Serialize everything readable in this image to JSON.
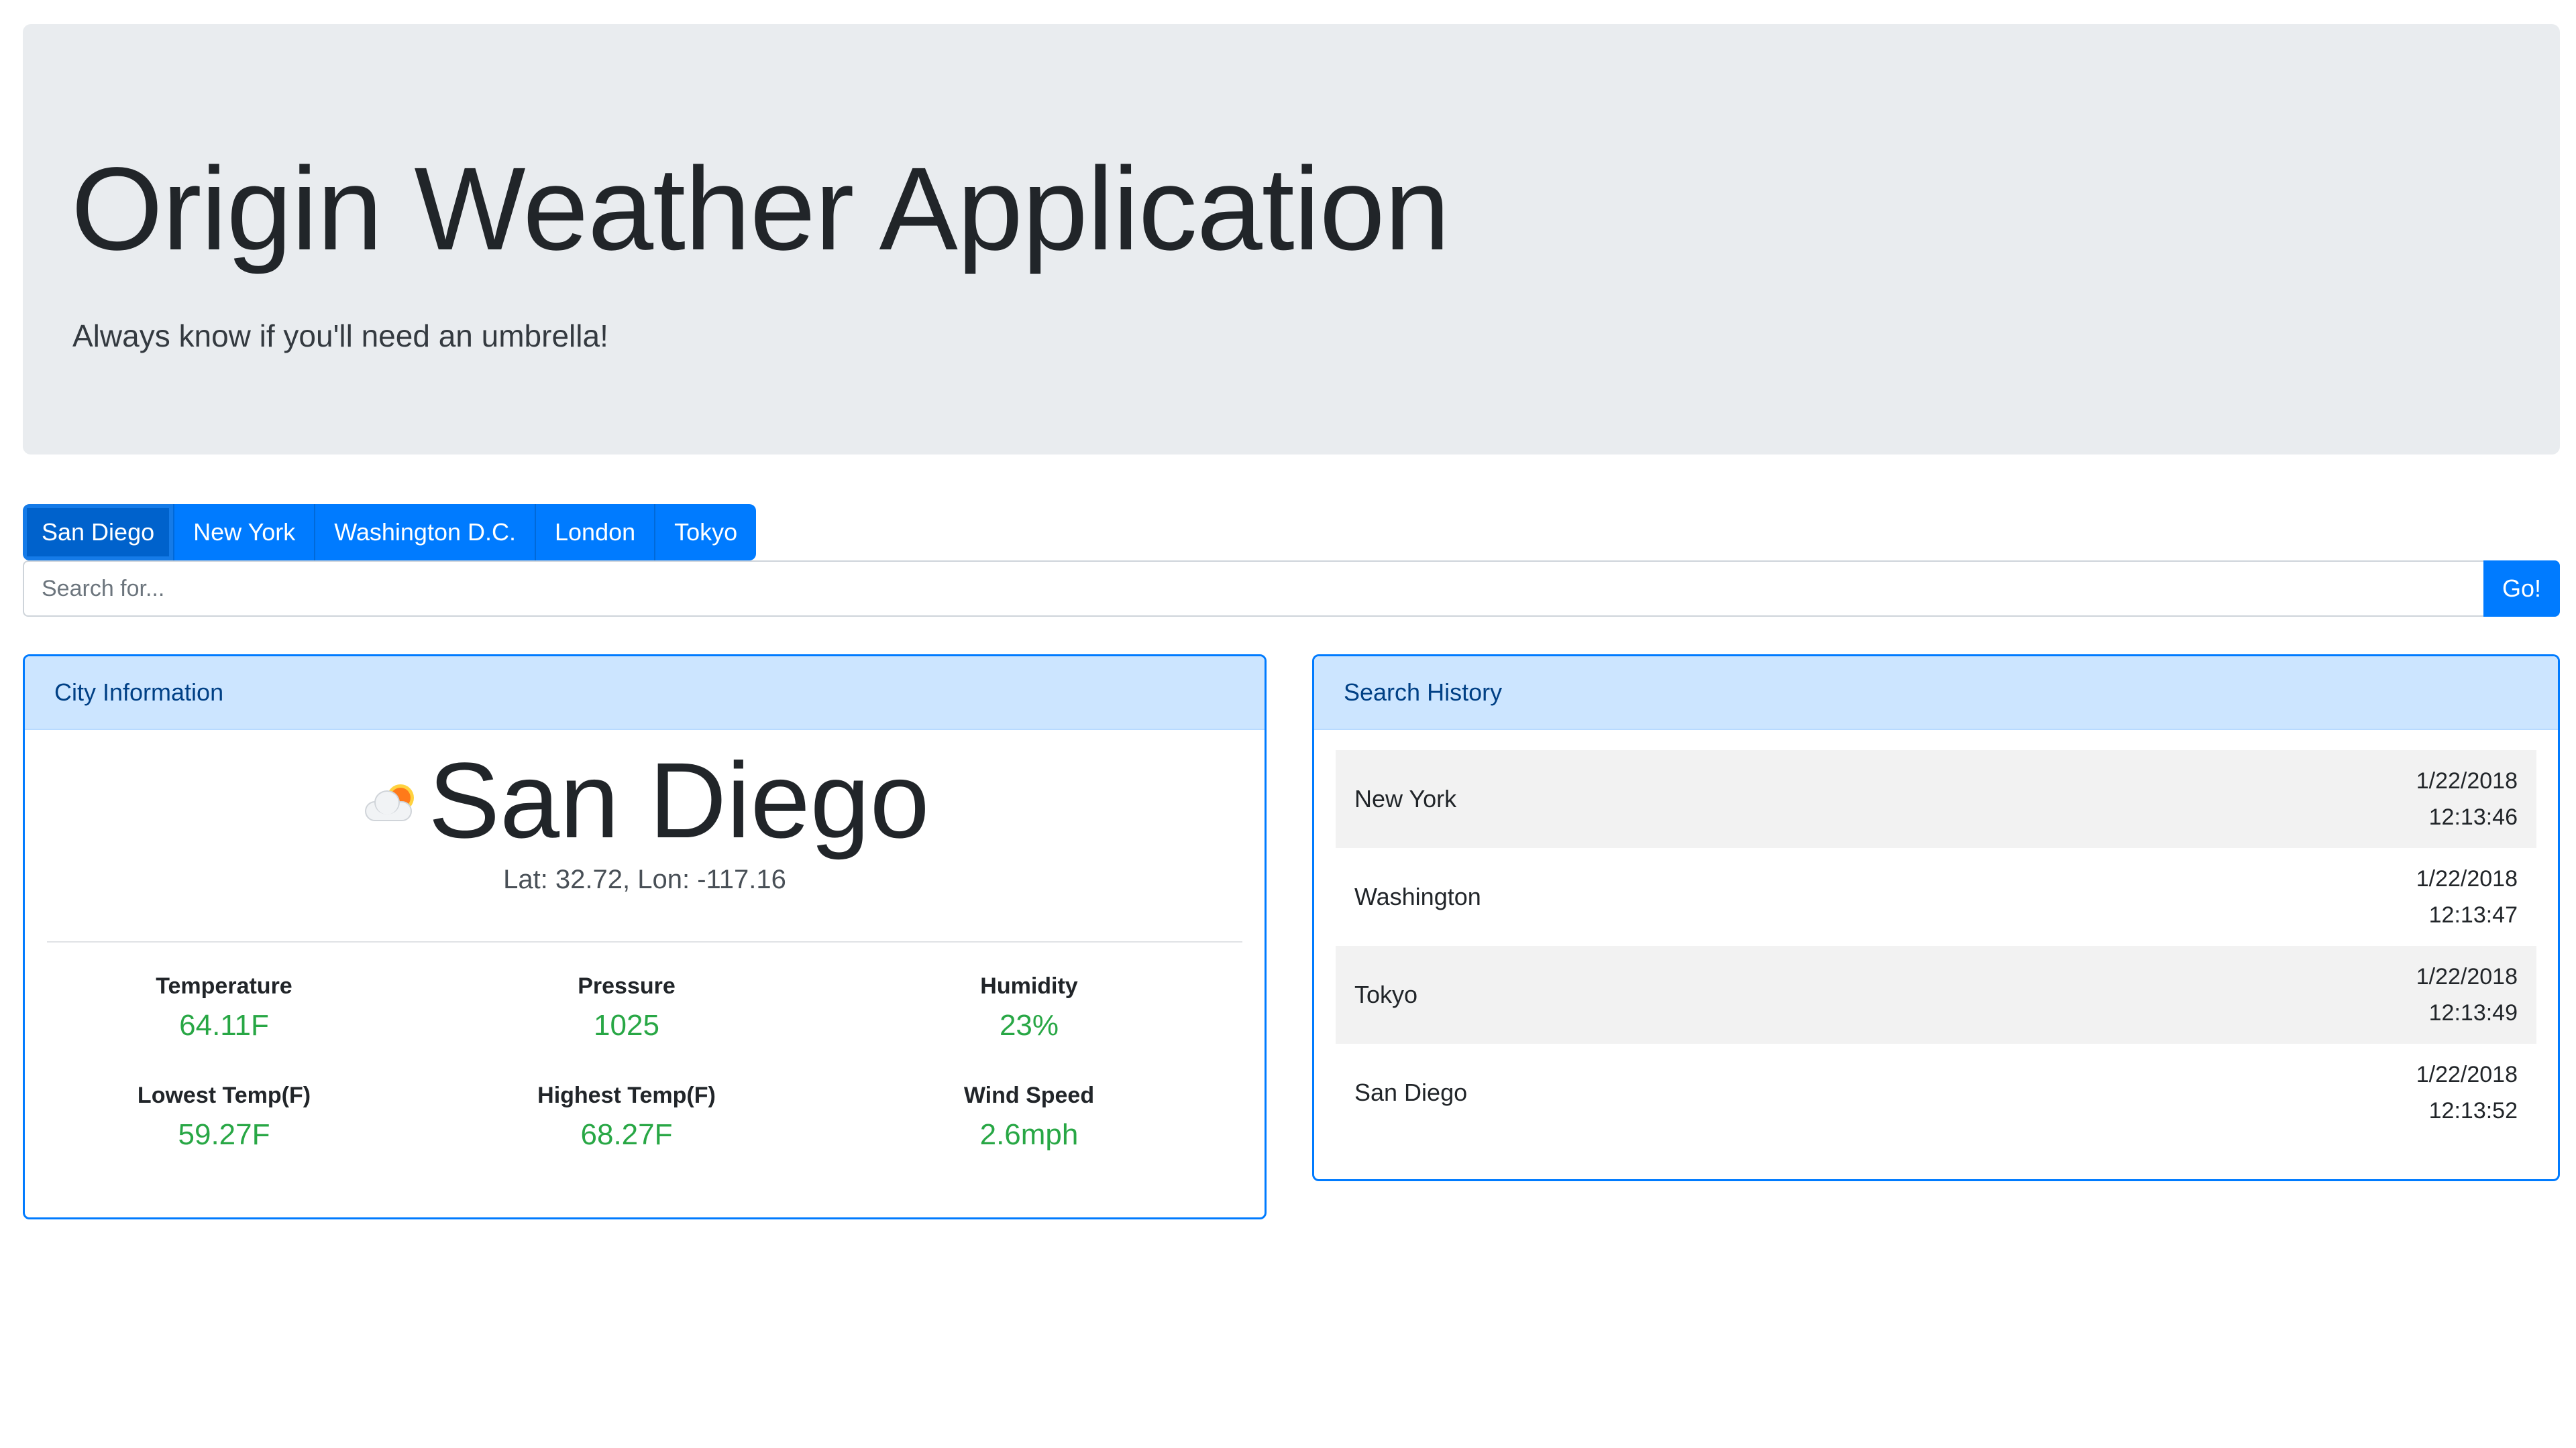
{
  "header": {
    "title": "Origin Weather Application",
    "subtitle": "Always know if you'll need an umbrella!"
  },
  "city_buttons": [
    {
      "label": "San Diego",
      "active": true
    },
    {
      "label": "New York",
      "active": false
    },
    {
      "label": "Washington D.C.",
      "active": false
    },
    {
      "label": "London",
      "active": false
    },
    {
      "label": "Tokyo",
      "active": false
    }
  ],
  "search": {
    "placeholder": "Search for...",
    "value": "",
    "go_label": "Go!"
  },
  "city_info": {
    "header": "City Information",
    "icon": "partly-cloudy-icon",
    "name": "San Diego",
    "coords": "Lat: 32.72, Lon: -117.16",
    "stats": [
      {
        "label": "Temperature",
        "value": "64.11F"
      },
      {
        "label": "Pressure",
        "value": "1025"
      },
      {
        "label": "Humidity",
        "value": "23%"
      },
      {
        "label": "Lowest Temp(F)",
        "value": "59.27F"
      },
      {
        "label": "Highest Temp(F)",
        "value": "68.27F"
      },
      {
        "label": "Wind Speed",
        "value": "2.6mph"
      }
    ]
  },
  "history": {
    "header": "Search History",
    "items": [
      {
        "city": "New York",
        "date": "1/22/2018",
        "time": "12:13:46"
      },
      {
        "city": "Washington",
        "date": "1/22/2018",
        "time": "12:13:47"
      },
      {
        "city": "Tokyo",
        "date": "1/22/2018",
        "time": "12:13:49"
      },
      {
        "city": "San Diego",
        "date": "1/22/2018",
        "time": "12:13:52"
      }
    ]
  },
  "colors": {
    "primary": "#007bff",
    "success": "#28a745",
    "jumbotron_bg": "#e9ecef",
    "card_header_bg": "#cce5ff"
  }
}
